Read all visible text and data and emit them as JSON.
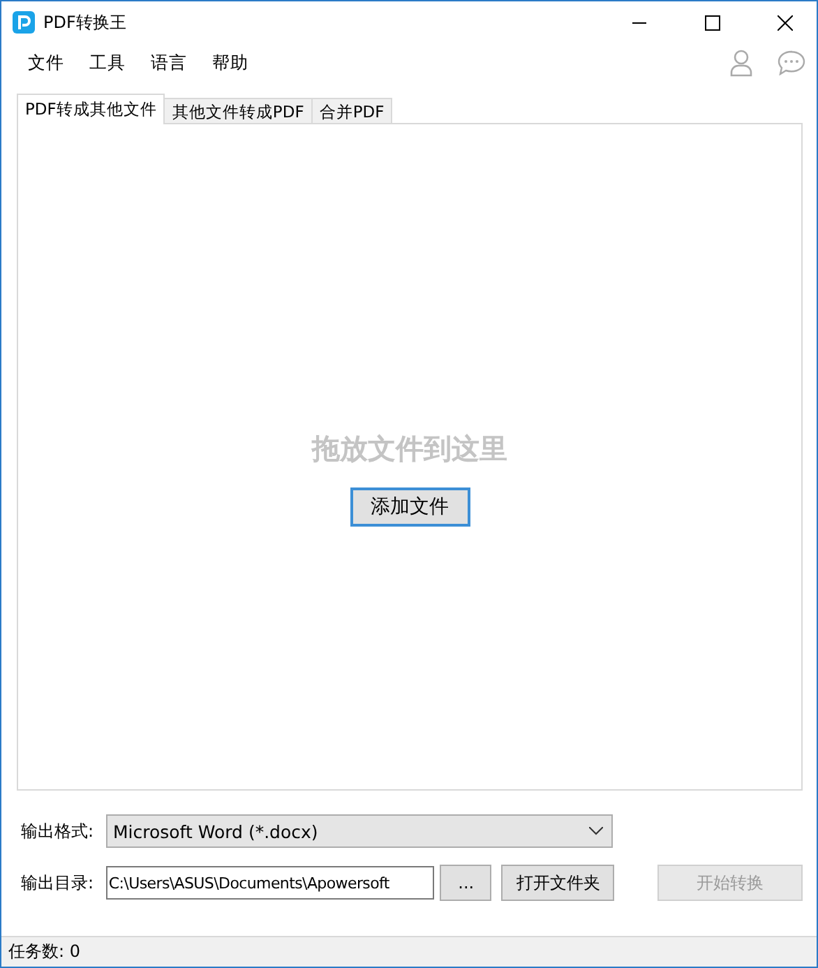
{
  "window": {
    "title": "PDF转换王"
  },
  "menu": [
    "文件",
    "工具",
    "语言",
    "帮助"
  ],
  "tabs": [
    {
      "label": "PDF转成其他文件",
      "selected": true
    },
    {
      "label": "其他文件转成PDF",
      "selected": false
    },
    {
      "label": "合并PDF",
      "selected": false
    }
  ],
  "drop_area": {
    "hint": "拖放文件到这里",
    "button": "添加文件"
  },
  "output_format": {
    "label": "输出格式:",
    "value": "Microsoft Word (*.docx)"
  },
  "output_dir": {
    "label": "输出目录:",
    "value": "C:\\Users\\ASUS\\Documents\\Apowersoft",
    "browse": "...",
    "open_folder": "打开文件夹"
  },
  "start_button": {
    "label": "开始转换",
    "disabled": true
  },
  "status_bar": {
    "text": "任务数: 0"
  }
}
